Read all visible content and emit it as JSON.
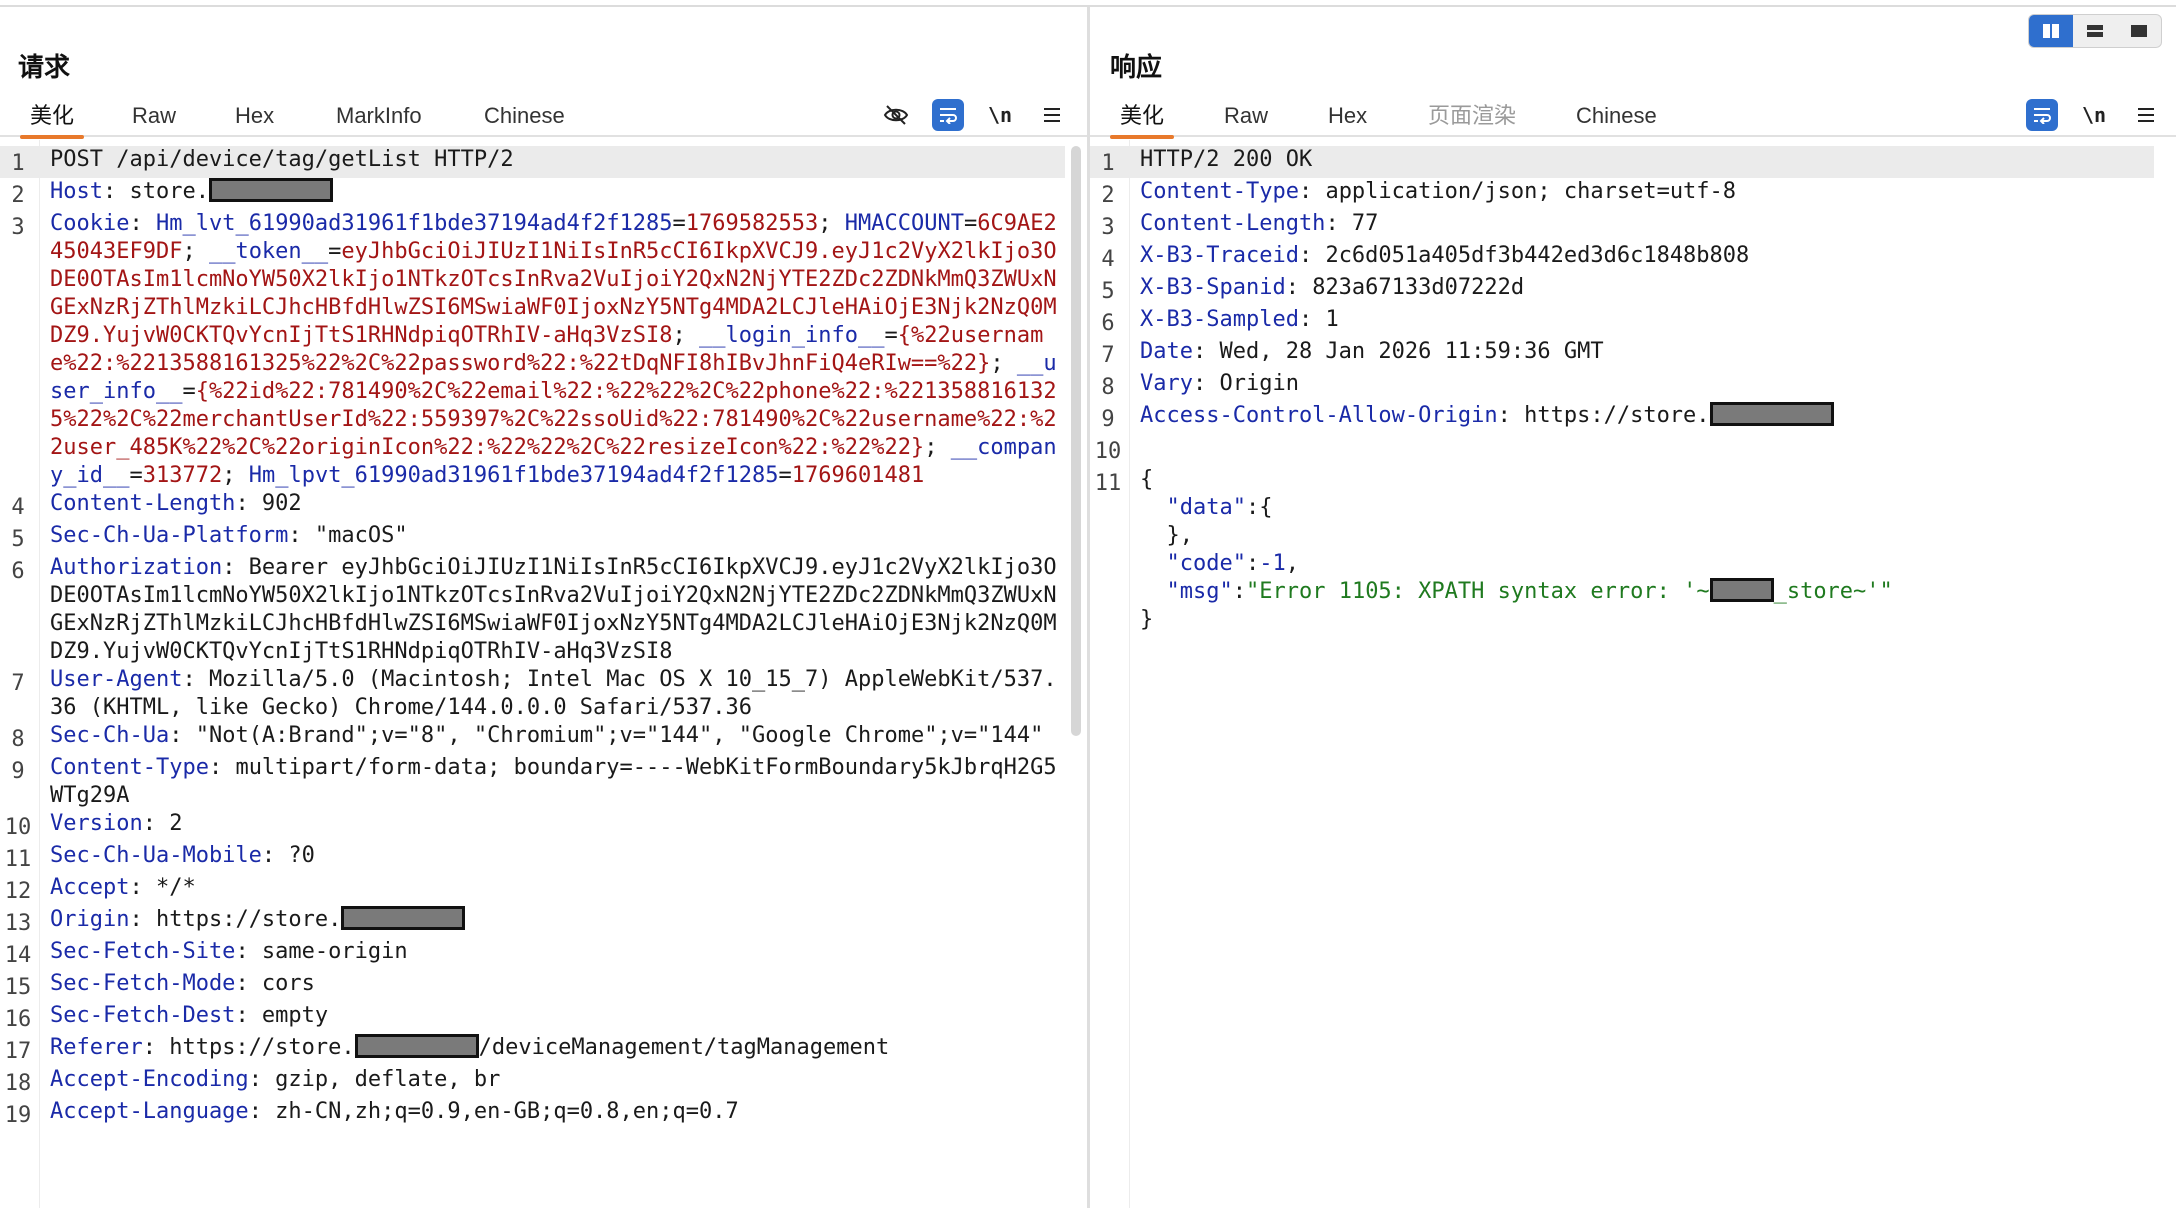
{
  "request": {
    "title": "请求",
    "tabs": [
      "美化",
      "Raw",
      "Hex",
      "MarkInfo",
      "Chinese"
    ],
    "active_tab": "美化",
    "toolbar": {
      "newline_label": "\\n"
    },
    "lines": [
      {
        "n": "1",
        "hl": true,
        "parts": [
          {
            "t": "POST /api/device/tag/getList HTTP/2",
            "c": "v"
          }
        ]
      },
      {
        "n": "2",
        "parts": [
          {
            "t": "Host",
            "c": "k"
          },
          {
            "t": ": store.",
            "c": "v"
          },
          {
            "redact": true
          }
        ]
      },
      {
        "n": "3",
        "parts": [
          {
            "t": "Cookie",
            "c": "k"
          },
          {
            "t": ": ",
            "c": "v"
          },
          {
            "t": "Hm_lvt_61990ad31961f1bde37194ad4f2f1285",
            "c": "k"
          },
          {
            "t": "=",
            "c": "v"
          },
          {
            "t": "1769582553",
            "c": "c"
          },
          {
            "t": "; ",
            "c": "v"
          },
          {
            "t": "HMACCOUNT",
            "c": "k"
          },
          {
            "t": "=",
            "c": "v"
          },
          {
            "t": "6C9AE245043EF9DF",
            "c": "c"
          },
          {
            "t": "; ",
            "c": "v"
          },
          {
            "t": "__token__",
            "c": "k"
          },
          {
            "t": "=",
            "c": "v"
          },
          {
            "t": "eyJhbGciOiJIUzI1NiIsInR5cCI6IkpXVCJ9.eyJ1c2VyX2lkIjo3ODE0OTAsIm1lcmNoYW50X2lkIjo1NTkzOTcsInRva2VuIjoiY2QxN2NjYTE2ZDc2ZDNkMmQ3ZWUxNGExNzRjZThlMzkiLCJhcHBfdHlwZSI6MSwiaWF0IjoxNzY5NTg4MDA2LCJleHAiOjE3Njk2NzQ0MDZ9.YujvW0CKTQvYcnIjTtS1RHNdpiqOTRhIV-aHq3VzSI8",
            "c": "c"
          },
          {
            "t": "; ",
            "c": "v"
          },
          {
            "t": "__login_info__",
            "c": "k"
          },
          {
            "t": "=",
            "c": "v"
          },
          {
            "t": "{%22username%22:%2213588161325%22%2C%22password%22:%22tDqNFI8hIBvJhnFiQ4eRIw==%22}",
            "c": "c"
          },
          {
            "t": "; ",
            "c": "v"
          },
          {
            "t": "__user_info__",
            "c": "k"
          },
          {
            "t": "=",
            "c": "v"
          },
          {
            "t": "{%22id%22:781490%2C%22email%22:%22%22%2C%22phone%22:%2213588161325%22%2C%22merchantUserId%22:559397%2C%22ssoUid%22:781490%2C%22username%22:%22user_485K%22%2C%22originIcon%22:%22%22%2C%22resizeIcon%22:%22%22}",
            "c": "c"
          },
          {
            "t": "; ",
            "c": "v"
          },
          {
            "t": "__company_id__",
            "c": "k"
          },
          {
            "t": "=",
            "c": "v"
          },
          {
            "t": "313772",
            "c": "c"
          },
          {
            "t": "; ",
            "c": "v"
          },
          {
            "t": "Hm_lpvt_61990ad31961f1bde37194ad4f2f1285",
            "c": "k"
          },
          {
            "t": "=",
            "c": "v"
          },
          {
            "t": "1769601481",
            "c": "c"
          }
        ]
      },
      {
        "n": "4",
        "parts": [
          {
            "t": "Content-Length",
            "c": "k"
          },
          {
            "t": ": 902",
            "c": "v"
          }
        ]
      },
      {
        "n": "5",
        "parts": [
          {
            "t": "Sec-Ch-Ua-Platform",
            "c": "k"
          },
          {
            "t": ": \"macOS\"",
            "c": "v"
          }
        ]
      },
      {
        "n": "6",
        "parts": [
          {
            "t": "Authorization",
            "c": "k"
          },
          {
            "t": ": Bearer eyJhbGciOiJIUzI1NiIsInR5cCI6IkpXVCJ9.eyJ1c2VyX2lkIjo3ODE0OTAsIm1lcmNoYW50X2lkIjo1NTkzOTcsInRva2VuIjoiY2QxN2NjYTE2ZDc2ZDNkMmQ3ZWUxNGExNzRjZThlMzkiLCJhcHBfdHlwZSI6MSwiaWF0IjoxNzY5NTg4MDA2LCJleHAiOjE3Njk2NzQ0MDZ9.YujvW0CKTQvYcnIjTtS1RHNdpiqOTRhIV-aHq3VzSI8",
            "c": "v"
          }
        ]
      },
      {
        "n": "7",
        "parts": [
          {
            "t": "User-Agent",
            "c": "k"
          },
          {
            "t": ": Mozilla/5.0 (Macintosh; Intel Mac OS X 10_15_7) AppleWebKit/537.36 (KHTML, like Gecko) Chrome/144.0.0.0 Safari/537.36",
            "c": "v"
          }
        ]
      },
      {
        "n": "8",
        "parts": [
          {
            "t": "Sec-Ch-Ua",
            "c": "k"
          },
          {
            "t": ": \"Not(A:Brand\";v=\"8\", \"Chromium\";v=\"144\", \"Google Chrome\";v=\"144\"",
            "c": "v"
          }
        ]
      },
      {
        "n": "9",
        "parts": [
          {
            "t": "Content-Type",
            "c": "k"
          },
          {
            "t": ": multipart/form-data; boundary=----WebKitFormBoundary5kJbrqH2G5WTg29A",
            "c": "v"
          }
        ]
      },
      {
        "n": "10",
        "parts": [
          {
            "t": "Version",
            "c": "k"
          },
          {
            "t": ": 2",
            "c": "v"
          }
        ]
      },
      {
        "n": "11",
        "parts": [
          {
            "t": "Sec-Ch-Ua-Mobile",
            "c": "k"
          },
          {
            "t": ": ?0",
            "c": "v"
          }
        ]
      },
      {
        "n": "12",
        "parts": [
          {
            "t": "Accept",
            "c": "k"
          },
          {
            "t": ": */*",
            "c": "v"
          }
        ]
      },
      {
        "n": "13",
        "parts": [
          {
            "t": "Origin",
            "c": "k"
          },
          {
            "t": ": https://store.",
            "c": "v"
          },
          {
            "redact": true
          }
        ]
      },
      {
        "n": "14",
        "parts": [
          {
            "t": "Sec-Fetch-Site",
            "c": "k"
          },
          {
            "t": ": same-origin",
            "c": "v"
          }
        ]
      },
      {
        "n": "15",
        "parts": [
          {
            "t": "Sec-Fetch-Mode",
            "c": "k"
          },
          {
            "t": ": cors",
            "c": "v"
          }
        ]
      },
      {
        "n": "16",
        "parts": [
          {
            "t": "Sec-Fetch-Dest",
            "c": "k"
          },
          {
            "t": ": empty",
            "c": "v"
          }
        ]
      },
      {
        "n": "17",
        "parts": [
          {
            "t": "Referer",
            "c": "k"
          },
          {
            "t": ": https://store.",
            "c": "v"
          },
          {
            "redact": true
          },
          {
            "t": "/deviceManagement/tagManagement",
            "c": "v"
          }
        ]
      },
      {
        "n": "18",
        "parts": [
          {
            "t": "Accept-Encoding",
            "c": "k"
          },
          {
            "t": ": gzip, deflate, br",
            "c": "v"
          }
        ]
      },
      {
        "n": "19",
        "parts": [
          {
            "t": "Accept-Language",
            "c": "k"
          },
          {
            "t": ": zh-CN,zh;q=0.9,en-GB;q=0.8,en;q=0.7",
            "c": "v"
          }
        ]
      }
    ]
  },
  "response": {
    "title": "响应",
    "tabs": [
      "美化",
      "Raw",
      "Hex",
      "页面渲染",
      "Chinese"
    ],
    "active_tab": "美化",
    "disabled_tab": "页面渲染",
    "toolbar": {
      "newline_label": "\\n"
    },
    "lines": [
      {
        "n": "1",
        "hl": true,
        "parts": [
          {
            "t": "HTTP/2 200 OK",
            "c": "v"
          }
        ]
      },
      {
        "n": "2",
        "parts": [
          {
            "t": "Content-Type",
            "c": "k"
          },
          {
            "t": ": application/json; charset=utf-8",
            "c": "v"
          }
        ]
      },
      {
        "n": "3",
        "parts": [
          {
            "t": "Content-Length",
            "c": "k"
          },
          {
            "t": ": 77",
            "c": "v"
          }
        ]
      },
      {
        "n": "4",
        "parts": [
          {
            "t": "X-B3-Traceid",
            "c": "k"
          },
          {
            "t": ": 2c6d051a405df3b442ed3d6c1848b808",
            "c": "v"
          }
        ]
      },
      {
        "n": "5",
        "parts": [
          {
            "t": "X-B3-Spanid",
            "c": "k"
          },
          {
            "t": ": 823a67133d07222d",
            "c": "v"
          }
        ]
      },
      {
        "n": "6",
        "parts": [
          {
            "t": "X-B3-Sampled",
            "c": "k"
          },
          {
            "t": ": 1",
            "c": "v"
          }
        ]
      },
      {
        "n": "7",
        "parts": [
          {
            "t": "Date",
            "c": "k"
          },
          {
            "t": ": Wed, 28 Jan 2026 11:59:36 GMT",
            "c": "v"
          }
        ]
      },
      {
        "n": "8",
        "parts": [
          {
            "t": "Vary",
            "c": "k"
          },
          {
            "t": ": Origin",
            "c": "v"
          }
        ]
      },
      {
        "n": "9",
        "parts": [
          {
            "t": "Access-Control-Allow-Origin",
            "c": "k"
          },
          {
            "t": ": https://store.",
            "c": "v"
          },
          {
            "redact": true
          }
        ]
      },
      {
        "n": "10",
        "parts": [
          {
            "t": "",
            "c": "v"
          }
        ]
      },
      {
        "n": "11",
        "parts": [
          {
            "t": "{\n  ",
            "c": "v"
          },
          {
            "t": "\"data\"",
            "c": "jk"
          },
          {
            "t": ":{\n  },\n  ",
            "c": "v"
          },
          {
            "t": "\"code\"",
            "c": "jk"
          },
          {
            "t": ":",
            "c": "v"
          },
          {
            "t": "-1",
            "c": "jn"
          },
          {
            "t": ",\n  ",
            "c": "v"
          },
          {
            "t": "\"msg\"",
            "c": "jk"
          },
          {
            "t": ":",
            "c": "v"
          },
          {
            "t": "\"Error 1105: XPATH syntax error: '~",
            "c": "js"
          },
          {
            "redact": true,
            "small": true
          },
          {
            "t": "_store~'\"",
            "c": "js"
          },
          {
            "t": "\n}",
            "c": "v"
          }
        ]
      }
    ]
  },
  "theme": {
    "accent": "#2f6fce",
    "tab_underline": "#e8792b",
    "header_key": "#1a2aa8",
    "cookie_value": "#a31515",
    "json_string": "#1f7a1f"
  }
}
